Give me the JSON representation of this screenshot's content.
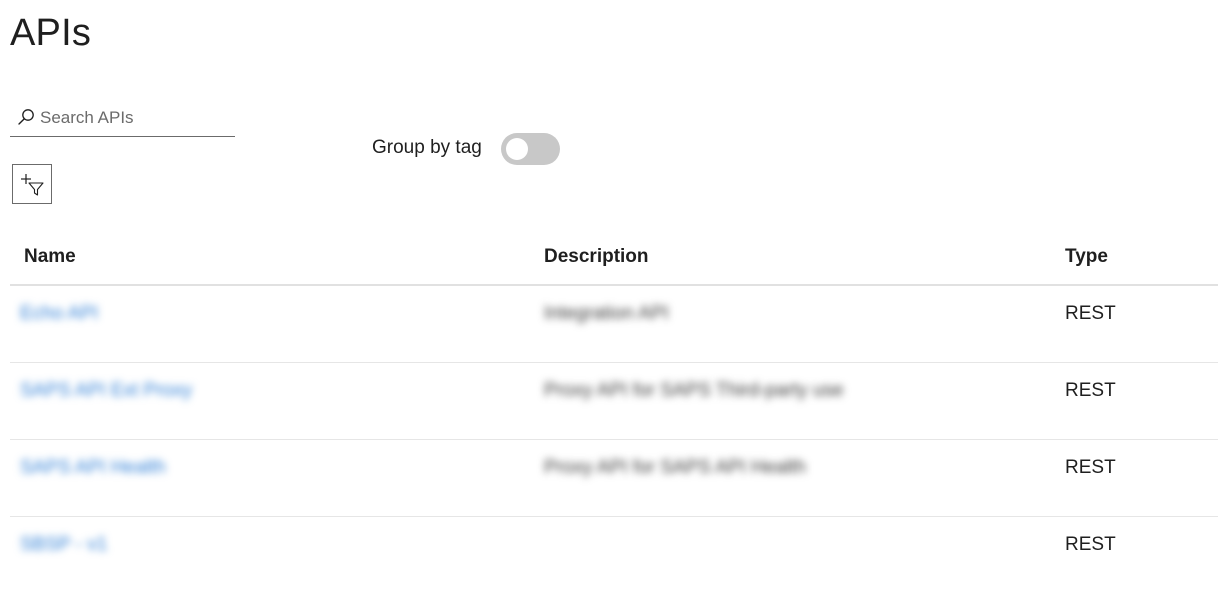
{
  "page": {
    "title": "APIs"
  },
  "search": {
    "placeholder": "Search APIs",
    "value": ""
  },
  "filter": {
    "icon": "add-filter-icon"
  },
  "group_by_tag": {
    "label": "Group by tag",
    "enabled": false
  },
  "table": {
    "columns": {
      "name": "Name",
      "description": "Description",
      "type": "Type"
    },
    "rows": [
      {
        "name": "Echo API",
        "description": "Integration API",
        "type": "REST"
      },
      {
        "name": "SAPS API Ext Proxy",
        "description": "Proxy API for SAPS Third-party use",
        "type": "REST"
      },
      {
        "name": "SAPS API Health",
        "description": "Proxy API for SAPS API Health",
        "type": "REST"
      },
      {
        "name": "SBSP - v1",
        "description": "",
        "type": "REST"
      }
    ]
  },
  "colors": {
    "link": "#2f7fd6",
    "toggle_off": "#c8c8c8",
    "divider": "#e1e1e1"
  }
}
